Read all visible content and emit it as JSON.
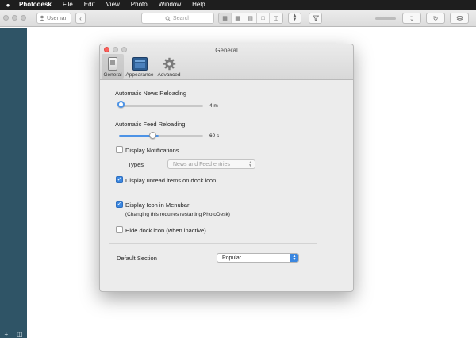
{
  "menubar": {
    "app_name": "Photodesk",
    "items": [
      "File",
      "Edit",
      "View",
      "Photo",
      "Window",
      "Help"
    ]
  },
  "toolbar": {
    "user_placeholder": "Usernar",
    "search_placeholder": "Search"
  },
  "dialog": {
    "title": "General",
    "tabs": [
      {
        "label": "General",
        "selected": true
      },
      {
        "label": "Appearance",
        "selected": false
      },
      {
        "label": "Advanced",
        "selected": false
      }
    ],
    "news_reloading": {
      "label": "Automatic News Reloading",
      "value": "4 m",
      "level": 0.0
    },
    "feed_reloading": {
      "label": "Automatic Feed Reloading",
      "value": "60 s",
      "level": 0.47
    },
    "display_notifications": {
      "label": "Display Notifications",
      "checked": false
    },
    "types": {
      "label": "Types",
      "value": "News and Feed entries"
    },
    "unread_dock": {
      "label": "Display unread items on dock icon",
      "checked": true
    },
    "menubar_icon": {
      "label": "Display Icon in Menubar",
      "checked": true,
      "note": "(Changing this requires restarting PhotoDesk)"
    },
    "hide_dock": {
      "label": "Hide dock icon (when inactive)",
      "checked": false
    },
    "default_section": {
      "label": "Default Section",
      "value": "Popular"
    }
  },
  "colors": {
    "sidebar": "#2f5466",
    "accent": "#3b87e0",
    "menubar": "#1e1e1e"
  }
}
